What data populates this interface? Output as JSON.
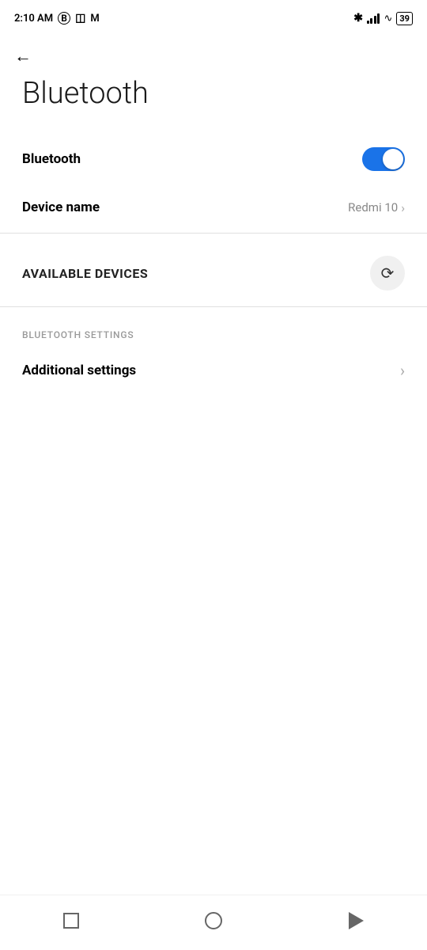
{
  "statusBar": {
    "time": "2:10 AM",
    "bluetooth_icon": "✱",
    "battery_level": "39"
  },
  "header": {
    "back_label": "←",
    "title": "Bluetooth"
  },
  "settings": {
    "bluetooth_label": "Bluetooth",
    "bluetooth_enabled": true,
    "device_name_label": "Device name",
    "device_name_value": "Redmi 10"
  },
  "available_devices": {
    "title": "AVAILABLE DEVICES",
    "refresh_label": "refresh"
  },
  "bluetooth_settings": {
    "section_label": "BLUETOOTH SETTINGS",
    "additional_settings_label": "Additional settings"
  },
  "nav": {
    "recents": "recents",
    "home": "home",
    "back": "back"
  }
}
